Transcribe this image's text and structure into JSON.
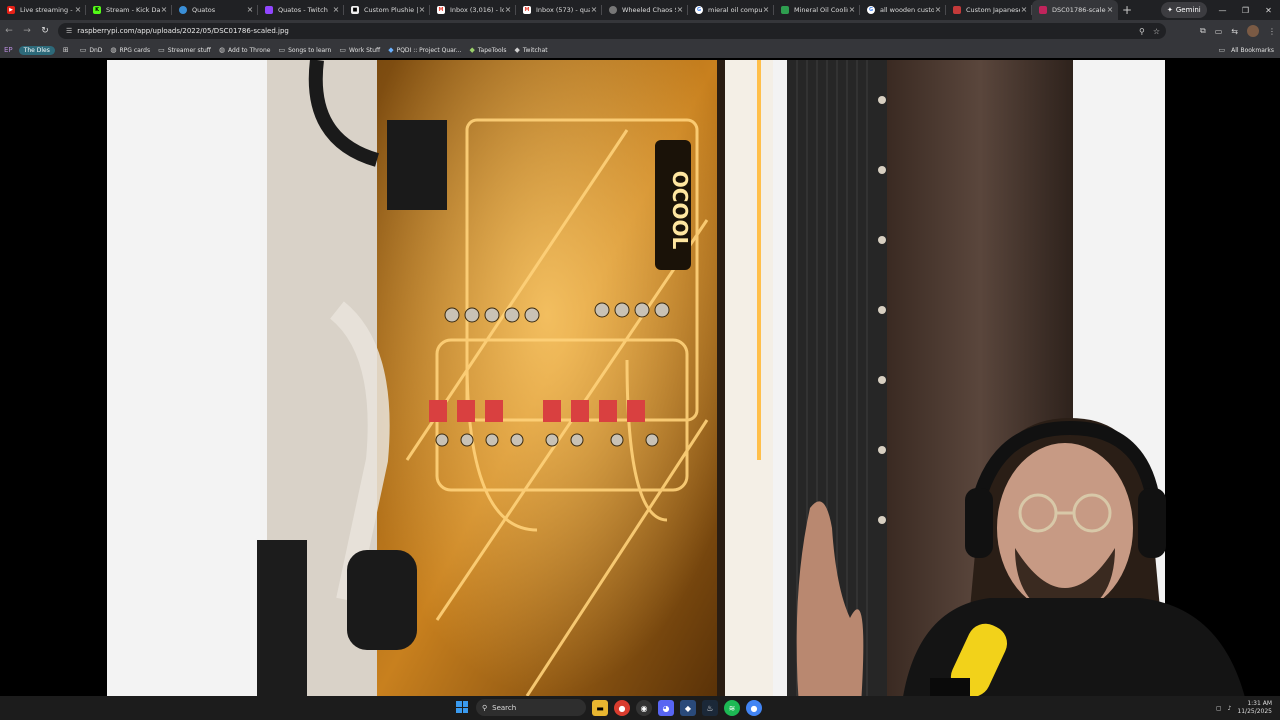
{
  "browser": {
    "tabs": [
      {
        "title": "Live streaming - Y",
        "icon": "youtube-icon",
        "color": "#e62117"
      },
      {
        "title": "Stream - Kick Dash",
        "icon": "kick-icon",
        "color": "#53fc18"
      },
      {
        "title": "Quatos",
        "icon": "quatos-icon",
        "color": "#3a8fd8"
      },
      {
        "title": "Quatos - Twitch",
        "icon": "twitch-icon",
        "color": "#9146ff"
      },
      {
        "title": "Custom Plushie | !",
        "icon": "plushie-icon",
        "color": "#eeeeee"
      },
      {
        "title": "Inbox (3,016) - lon",
        "icon": "gmail-icon",
        "color": "#ea4335"
      },
      {
        "title": "Inbox (573) - quat",
        "icon": "gmail-icon",
        "color": "#ea4335"
      },
      {
        "title": "Wheeled Chaos Sc",
        "icon": "globe-icon",
        "color": "#888888"
      },
      {
        "title": "mieral oil comput",
        "icon": "google-icon",
        "color": "#4285f4"
      },
      {
        "title": "Mineral Oil Coolin",
        "icon": "site-icon",
        "color": "#2e9e4f"
      },
      {
        "title": "all wooden custon",
        "icon": "google-icon",
        "color": "#4285f4"
      },
      {
        "title": "Custom Japanese",
        "icon": "site-icon",
        "color": "#c43a3a"
      },
      {
        "title": "DSC01786-scaled.",
        "icon": "image-icon",
        "color": "#c0245c",
        "active": true
      }
    ],
    "new_tab_label": "+",
    "gemini_label": "Gemini",
    "url": "raspberrypi.com/app/uploads/2022/05/DSC01786-scaled.jpg",
    "bookmarks": [
      {
        "label": "The Dles",
        "icon": "pill-icon"
      },
      {
        "label": "DnD",
        "icon": "folder-icon"
      },
      {
        "label": "RPG cards",
        "icon": "globe-icon"
      },
      {
        "label": "Streamer stuff",
        "icon": "folder-icon"
      },
      {
        "label": "Add to Throne",
        "icon": "globe-icon"
      },
      {
        "label": "Songs to learn",
        "icon": "folder-icon"
      },
      {
        "label": "Work Stuff",
        "icon": "folder-icon"
      },
      {
        "label": "PQDI :: Project Quar...",
        "icon": "site-icon"
      },
      {
        "label": "TapeTools",
        "icon": "site-icon"
      },
      {
        "label": "Twitchat",
        "icon": "site-icon"
      }
    ],
    "all_bookmarks_label": "All Bookmarks"
  },
  "taskbar": {
    "search_label": "Search",
    "time": "1:31 AM",
    "date": "11/25/2025"
  }
}
